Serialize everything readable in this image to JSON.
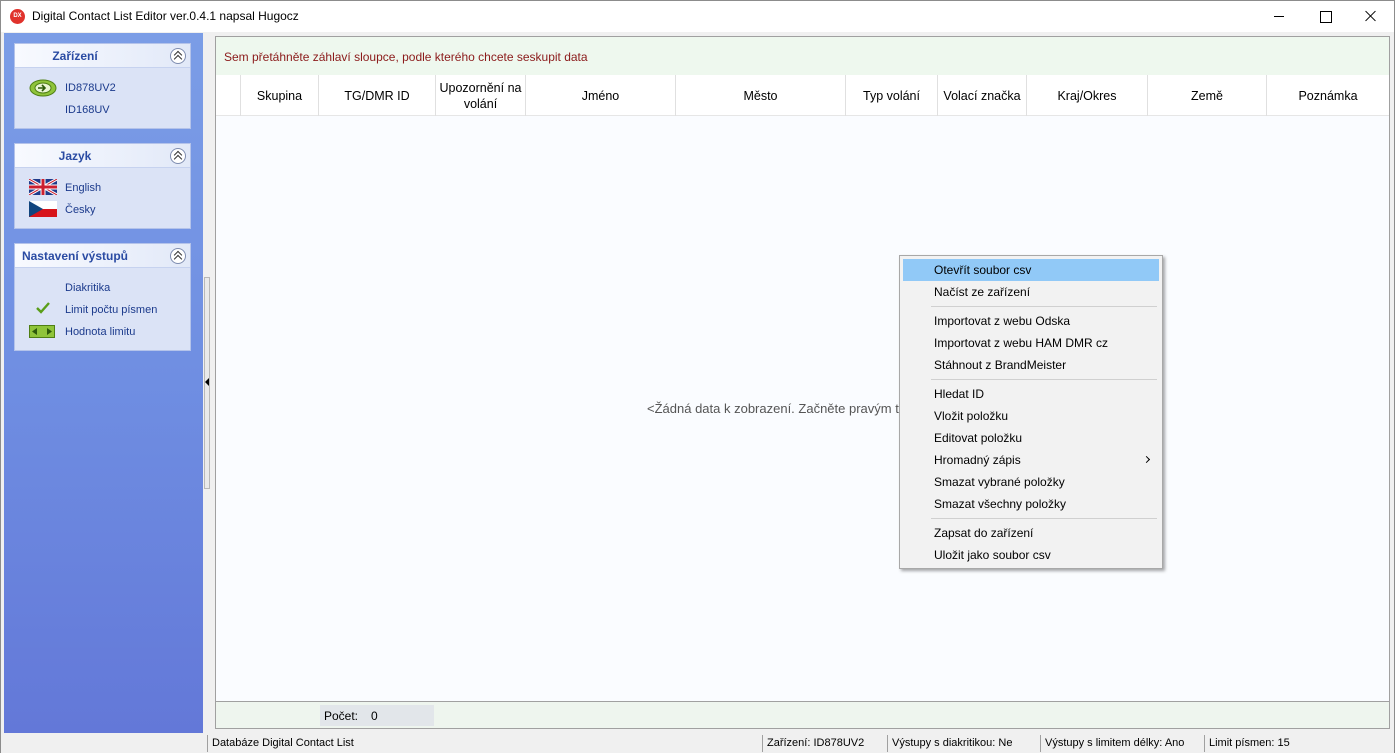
{
  "window": {
    "title": "Digital Contact List Editor ver.0.4.1 napsal Hugocz",
    "icon_text": "DX"
  },
  "nav": {
    "groups": [
      {
        "title": "Zařízení",
        "items": [
          {
            "label": "ID878UV2",
            "icon": "arrow-circle-icon"
          },
          {
            "label": "ID168UV",
            "icon": ""
          }
        ]
      },
      {
        "title": "Jazyk",
        "items": [
          {
            "label": "English",
            "icon": "uk-flag-icon"
          },
          {
            "label": "Česky",
            "icon": "czech-flag-icon"
          }
        ]
      },
      {
        "title": "Nastavení výstupů",
        "items": [
          {
            "label": "Diakritika",
            "icon": ""
          },
          {
            "label": "Limit počtu písmen",
            "icon": "checkmark-icon"
          },
          {
            "label": "Hodnota limitu",
            "icon": "range-icon"
          }
        ]
      }
    ]
  },
  "grid": {
    "group_panel_text": "Sem přetáhněte záhlaví sloupce, podle kterého chcete seskupit data",
    "columns": [
      "Skupina",
      "TG/DMR ID",
      "Upozornění na volání",
      "Jméno",
      "Město",
      "Typ volání",
      "Volací značka",
      "Kraj/Okres",
      "Země",
      "Poznámka"
    ],
    "empty_text": "<Žádná data k zobrazení. Začněte pravým tl",
    "footer": {
      "count_label": "Počet:",
      "count_value": "0"
    }
  },
  "statusbar": {
    "database": "Databáze Digital Contact List",
    "device": "Zařízení: ID878UV2",
    "diacritics": "Výstupy s diakritikou: Ne",
    "length_limit": "Výstupy s limitem délky: Ano",
    "char_limit": "Limit písmen: 15"
  },
  "context_menu": {
    "items": [
      "Otevřít soubor csv",
      "Načíst ze zařízení",
      "Importovat z webu Odska",
      "Importovat z webu HAM DMR cz",
      "Stáhnout z BrandMeister",
      "Hledat ID",
      "Vložit položku",
      "Editovat položku",
      "Hromadný zápis",
      "Smazat vybrané položky",
      "Smazat všechny položky",
      "Zapsat do zařízení",
      "Uložit jako soubor csv"
    ],
    "highlighted": "Otevřít soubor csv",
    "highlight_color": "#91c9f7"
  }
}
